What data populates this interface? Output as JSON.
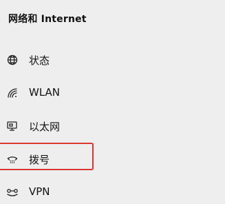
{
  "section": {
    "title": "网络和 Internet"
  },
  "nav": {
    "items": [
      {
        "label": "状态",
        "icon": "globe-icon"
      },
      {
        "label": "WLAN",
        "icon": "wifi-icon"
      },
      {
        "label": "以太网",
        "icon": "ethernet-icon"
      },
      {
        "label": "拨号",
        "icon": "dialup-icon"
      },
      {
        "label": "VPN",
        "icon": "vpn-icon"
      }
    ]
  },
  "highlight": {
    "color": "#d8382f",
    "target": "拨号"
  }
}
